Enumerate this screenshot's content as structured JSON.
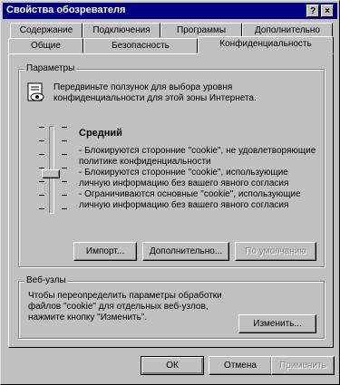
{
  "window": {
    "title": "Свойства обозревателя"
  },
  "titlebar_buttons": {
    "help": "?",
    "close": "×"
  },
  "tabs_row1": [
    "Содержание",
    "Подключения",
    "Программы",
    "Дополнительно"
  ],
  "tabs_row2": [
    "Общие",
    "Безопасность",
    "Конфиденциальность"
  ],
  "settings": {
    "group_label": "Параметры",
    "intro": "Передвиньте ползунок для выбора уровня конфиденциальности для этой зоны Интернета.",
    "level_title": "Средний",
    "bullets": [
      "- Блокируются сторонние \"cookie\", не удовлетворяющие политике конфиденциальности",
      "- Блокируются сторонние \"cookie\", использующие личную информацию без вашего явного согласия",
      "- Ограничиваются основные \"cookie\", использующие личную информацию без вашего явного согласия"
    ],
    "buttons": {
      "import": "Импорт...",
      "advanced": "Дополнительно...",
      "default": "По умолчанию"
    }
  },
  "websites": {
    "group_label": "Веб-узлы",
    "description": "Чтобы переопределить параметры обработки файлов \"cookie\" для отдельных веб-узлов, нажмите кнопку \"Изменить\".",
    "edit_button": "Изменить..."
  },
  "footer": {
    "ok": "ОК",
    "cancel": "Отмена",
    "apply": "Применить"
  },
  "slider": {
    "level": "Средний"
  }
}
